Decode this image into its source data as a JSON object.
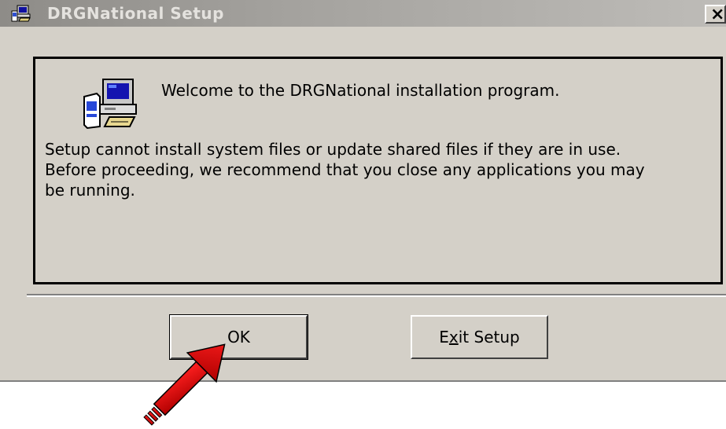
{
  "window": {
    "title": "DRGNational Setup",
    "close_glyph": "×"
  },
  "content": {
    "welcome": "Welcome to the DRGNational installation program.",
    "body_lines": [
      "Setup cannot install system files or update shared files if they are in use.",
      "Before proceeding, we recommend that you close any applications you may",
      "be running."
    ]
  },
  "buttons": {
    "ok_label": "OK",
    "exit_label_pre": "E",
    "exit_label_mnemonic": "x",
    "exit_label_post": "it Setup"
  },
  "icons": {
    "title_icon": "setup-computer-icon",
    "main_icon": "setup-computer-icon",
    "annotation": "red-arrow-icon"
  },
  "colors": {
    "dialog_bg": "#d4d0c8",
    "titlebar_inactive": "#8e8c88",
    "arrow_red": "#e01010"
  }
}
